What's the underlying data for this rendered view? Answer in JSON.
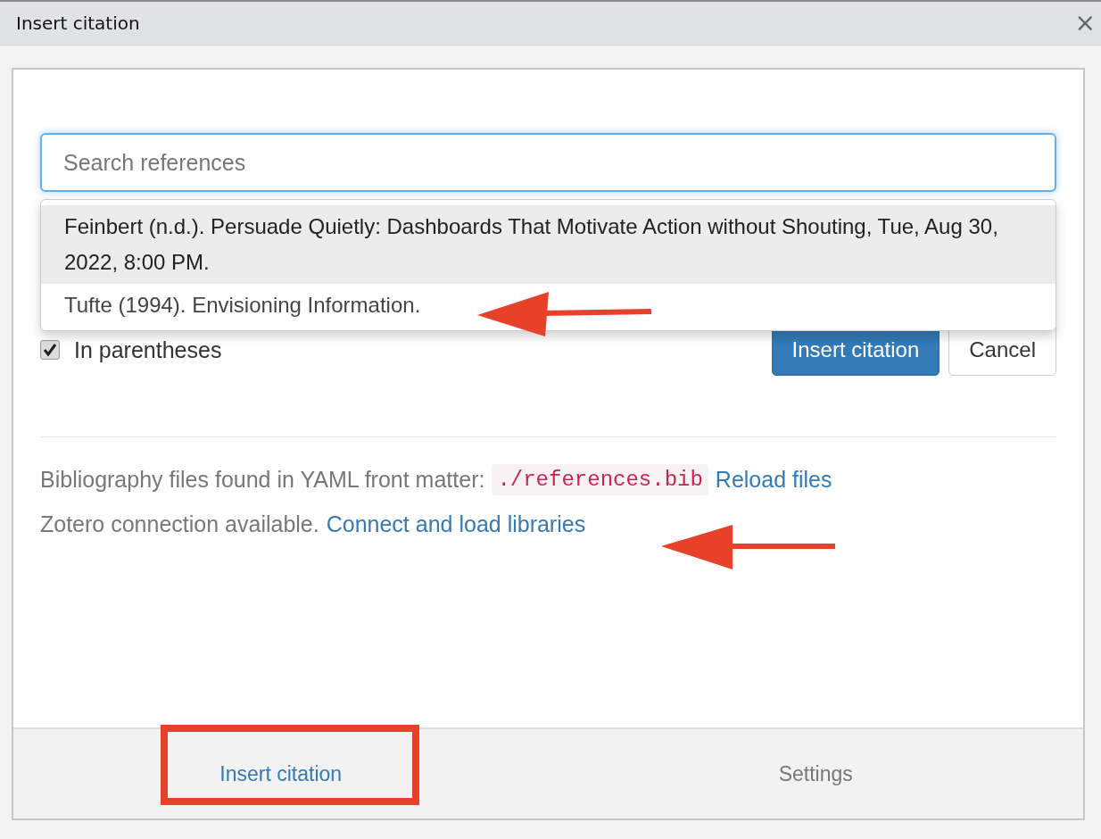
{
  "window": {
    "title": "Insert citation",
    "close": "×"
  },
  "search": {
    "placeholder": "Search references"
  },
  "suggestions": [
    {
      "text": "Feinbert (n.d.). Persuade Quietly: Dashboards That Motivate Action without Shouting, Tue, Aug 30, 2022, 8:00 PM.",
      "selected": true
    },
    {
      "text": "Tufte (1994). Envisioning Information.",
      "selected": false
    }
  ],
  "options": {
    "in_parentheses": {
      "label": "In parentheses",
      "checked": true
    }
  },
  "buttons": [
    {
      "label": "Insert citation",
      "kind": "primary"
    },
    {
      "label": "Cancel",
      "kind": "default"
    }
  ],
  "sources": [
    {
      "text": "Bibliography files found in YAML front matter:",
      "code": "./references.bib",
      "link": "Reload files"
    },
    {
      "text": "Zotero connection available.",
      "link": "Connect and load libraries"
    }
  ],
  "tabs": [
    {
      "label": "Insert citation",
      "selected": true
    },
    {
      "label": "Settings",
      "selected": false
    }
  ]
}
